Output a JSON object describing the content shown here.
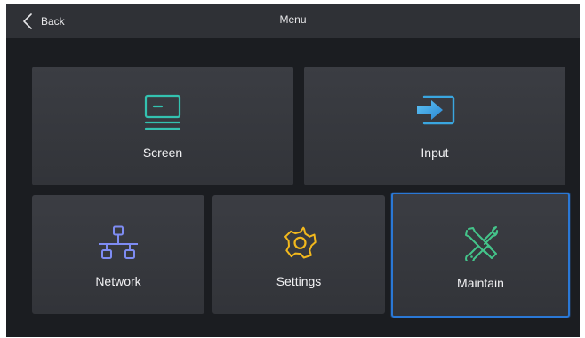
{
  "header": {
    "back_label": "Back",
    "title": "Menu"
  },
  "tiles": [
    {
      "label": "Screen",
      "icon": "monitor-icon",
      "icon_color": "#33c2b0"
    },
    {
      "label": "Input",
      "icon": "input-arrow-icon",
      "icon_color": "#3aa6e0"
    },
    {
      "label": "Network",
      "icon": "network-icon",
      "icon_color": "#7e8cf3"
    },
    {
      "label": "Settings",
      "icon": "gear-icon",
      "icon_color": "#f2b81d"
    },
    {
      "label": "Maintain",
      "icon": "wrench-screwdriver-icon",
      "icon_color": "#44c48a"
    }
  ],
  "selected_tile": "Maintain",
  "colors": {
    "background": "#1b1d21",
    "header": "#2f3136",
    "tile": "#37393e",
    "selection_border": "#2a78d6"
  }
}
